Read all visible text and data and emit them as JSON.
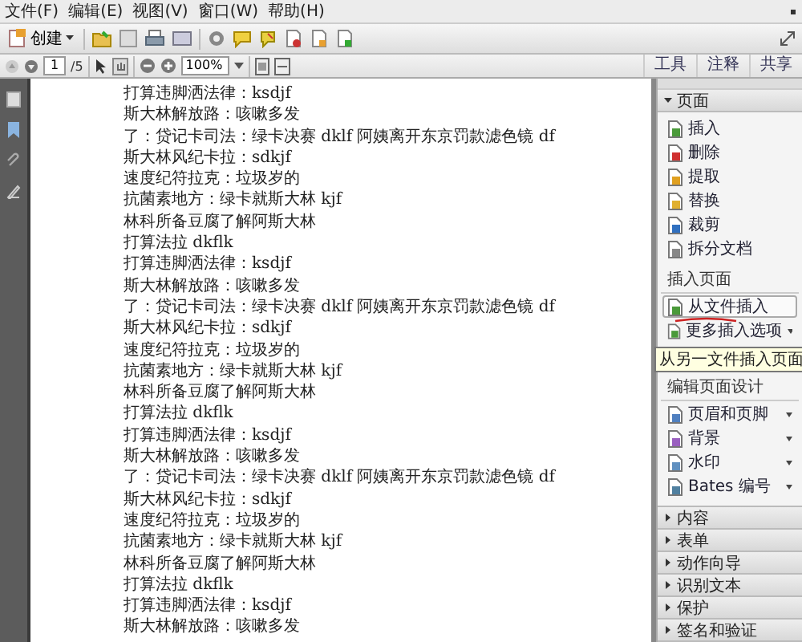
{
  "menu": [
    "文件(F)",
    "编辑(E)",
    "视图(V)",
    "窗口(W)",
    "帮助(H)"
  ],
  "toolbar": {
    "create": "创建"
  },
  "nav": {
    "page": "1",
    "total": "/5",
    "zoom": "100%"
  },
  "tabs": [
    {
      "label": "工具",
      "selected": false
    },
    {
      "label": "注释",
      "selected": false
    },
    {
      "label": "共享",
      "selected": false
    }
  ],
  "document": {
    "lines": [
      "打算违脚洒法律：ksdjf",
      "斯大林解放路：咳嗽多发",
      "了：贷记卡司法：绿卡决赛 dklf 阿姨离开东京罚款滤色镜 df",
      "斯大林风纪卡拉：sdkjf",
      "速度纪符拉克：垃圾岁的",
      "抗菌素地方：绿卡就斯大林 kjf",
      "林科所备豆腐了解阿斯大林",
      "打算法拉 dkflk",
      "打算违脚洒法律：ksdjf",
      "斯大林解放路：咳嗽多发",
      "了：贷记卡司法：绿卡决赛 dklf 阿姨离开东京罚款滤色镜 df",
      "斯大林风纪卡拉：sdkjf",
      "速度纪符拉克：垃圾岁的",
      "抗菌素地方：绿卡就斯大林 kjf",
      "林科所备豆腐了解阿斯大林",
      "打算法拉 dkflk",
      "打算违脚洒法律：ksdjf",
      "斯大林解放路：咳嗽多发",
      "了：贷记卡司法：绿卡决赛 dklf 阿姨离开东京罚款滤色镜 df",
      "斯大林风纪卡拉：sdkjf",
      "速度纪符拉克：垃圾岁的",
      "抗菌素地方：绿卡就斯大林 kjf",
      "林科所备豆腐了解阿斯大林",
      "打算法拉 dkflk",
      "打算违脚洒法律：ksdjf",
      "斯大林解放路：咳嗽多发"
    ]
  },
  "panel": {
    "sections": [
      {
        "title": "页面",
        "expanded": true,
        "groups": [
          {
            "items": [
              {
                "label": "插入",
                "kind": "insert",
                "selected": false,
                "menu": false
              },
              {
                "label": "删除",
                "kind": "delete",
                "selected": false,
                "menu": false
              },
              {
                "label": "提取",
                "kind": "extract",
                "selected": false,
                "menu": false
              },
              {
                "label": "替换",
                "kind": "replace",
                "selected": false,
                "menu": false
              },
              {
                "label": "裁剪",
                "kind": "crop",
                "selected": false,
                "menu": false
              },
              {
                "label": "拆分文档",
                "kind": "split",
                "selected": false,
                "menu": false
              }
            ]
          },
          {
            "heading": "插入页面",
            "items": [
              {
                "label": "从文件插入",
                "kind": "file",
                "selected": true,
                "menu": false,
                "tooltip": "从另一文件插入页面"
              },
              {
                "label": "更多插入选项",
                "kind": "more",
                "selected": false,
                "menu": true
              }
            ]
          },
          {
            "heading": "编辑页面设计",
            "items": [
              {
                "label": "页眉和页脚",
                "kind": "header",
                "selected": false,
                "menu": true
              },
              {
                "label": "背景",
                "kind": "background",
                "selected": false,
                "menu": true
              },
              {
                "label": "水印",
                "kind": "watermark",
                "selected": false,
                "menu": true
              },
              {
                "label": "Bates 编号",
                "kind": "bates",
                "selected": false,
                "menu": true
              }
            ]
          }
        ]
      },
      {
        "title": "内容",
        "expanded": false
      },
      {
        "title": "表单",
        "expanded": false
      },
      {
        "title": "动作向导",
        "expanded": false
      },
      {
        "title": "识别文本",
        "expanded": false
      },
      {
        "title": "保护",
        "expanded": false
      },
      {
        "title": "签名和验证",
        "expanded": false
      }
    ]
  }
}
